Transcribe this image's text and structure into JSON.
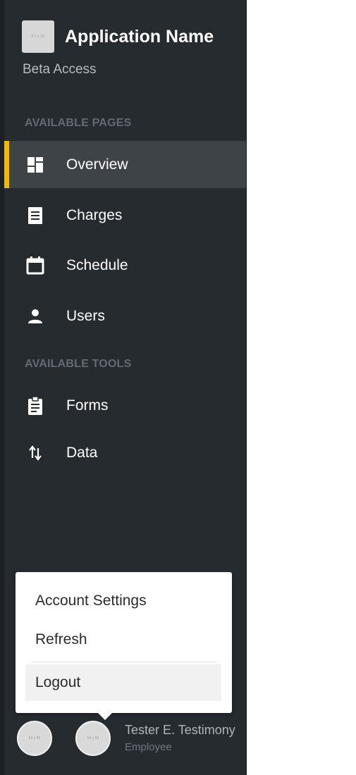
{
  "brand": {
    "logo_text": "32 x 32",
    "app_name": "Application Name",
    "subtitle": "Beta Access"
  },
  "sections": {
    "pages_label": "AVAILABLE PAGES",
    "tools_label": "AVAILABLE TOOLS"
  },
  "nav": {
    "overview": {
      "label": "Overview",
      "icon": "dashboard-icon",
      "active": true
    },
    "charges": {
      "label": "Charges",
      "icon": "receipt-icon"
    },
    "schedule": {
      "label": "Schedule",
      "icon": "calendar-icon"
    },
    "users": {
      "label": "Users",
      "icon": "person-icon"
    },
    "forms": {
      "label": "Forms",
      "icon": "clipboard-icon"
    },
    "data": {
      "label": "Data",
      "icon": "swap-vertical-icon"
    }
  },
  "menu": {
    "account_settings": "Account Settings",
    "refresh": "Refresh",
    "logout": "Logout"
  },
  "user": {
    "avatar_text": "50 x 50",
    "name": "Tester E. Testimony",
    "role": "Employee"
  },
  "colors": {
    "sidebar_bg": "#262b30",
    "active_bg": "#3e4347",
    "accent": "#f2b705"
  }
}
